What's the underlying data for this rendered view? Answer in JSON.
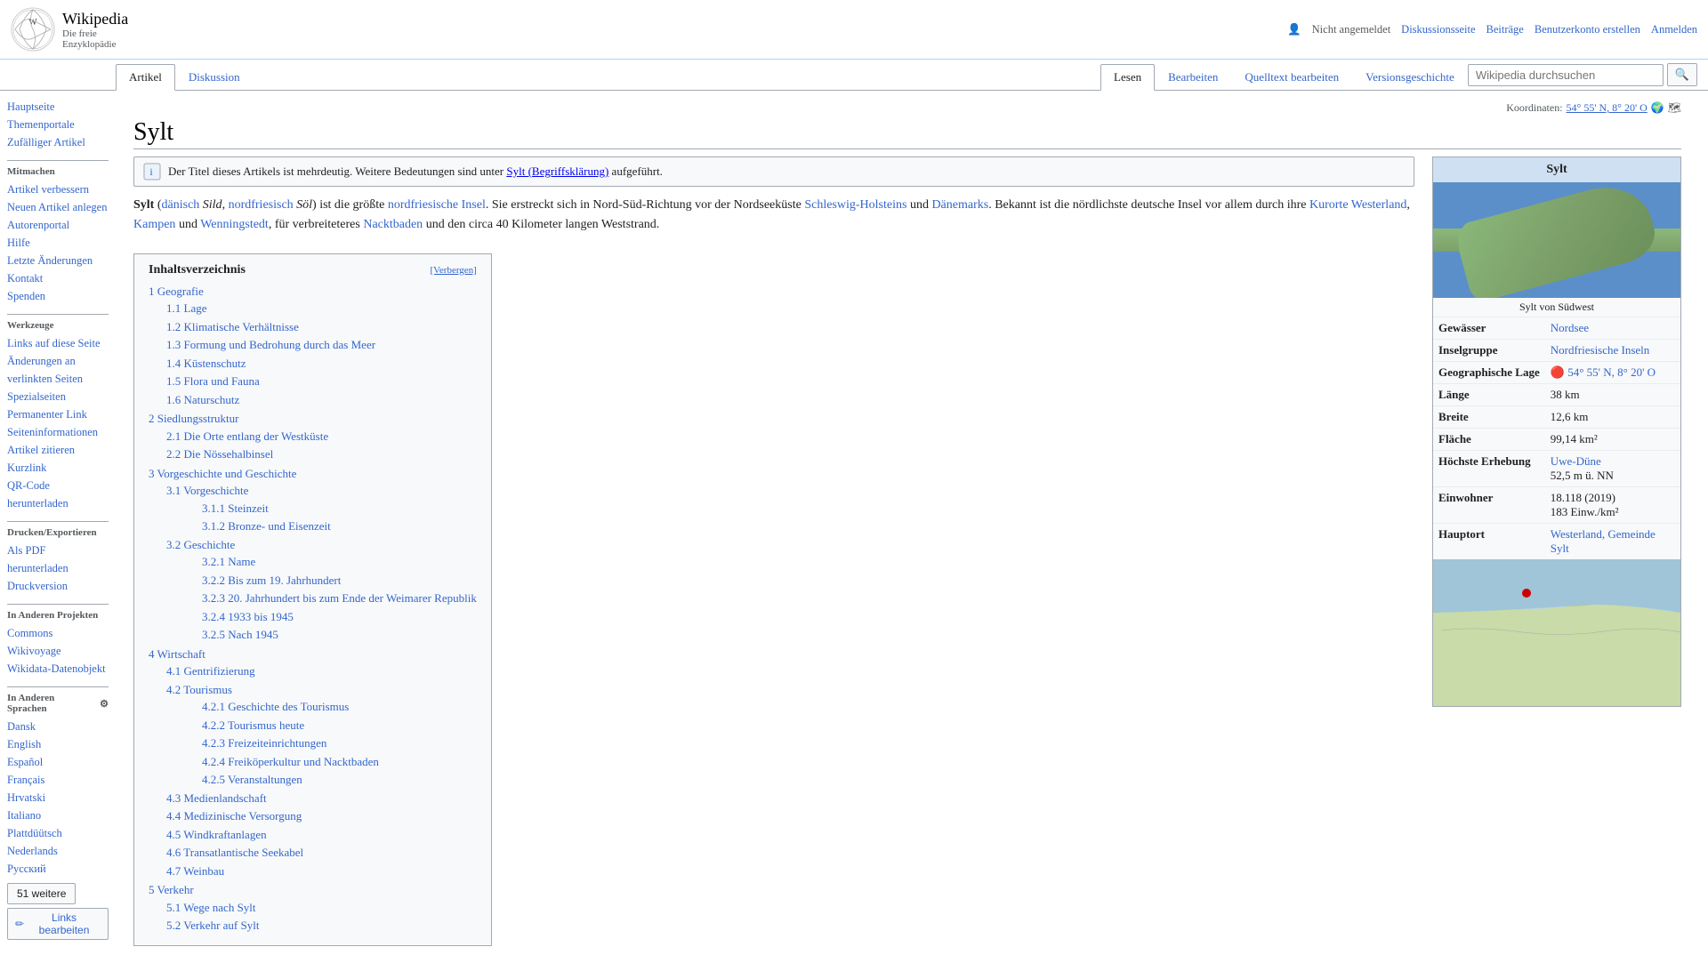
{
  "header": {
    "logo_title": "Wikipedia",
    "logo_subtitle": "Die freie Enzyklopädie",
    "top_nav": [
      {
        "label": "Nicht angemeldet",
        "type": "text"
      },
      {
        "label": "Diskussionsseite",
        "type": "link"
      },
      {
        "label": "Beiträge",
        "type": "link"
      },
      {
        "label": "Benutzerkonto erstellen",
        "type": "link"
      },
      {
        "label": "Anmelden",
        "type": "link"
      }
    ],
    "search_placeholder": "Wikipedia durchsuchen",
    "search_btn": "🔍"
  },
  "tabs": [
    {
      "label": "Artikel",
      "active": true
    },
    {
      "label": "Diskussion",
      "active": false
    },
    {
      "label": "Lesen",
      "active": false
    },
    {
      "label": "Bearbeiten",
      "active": false
    },
    {
      "label": "Quelltext bearbeiten",
      "active": false
    },
    {
      "label": "Versionsgeschichte",
      "active": false
    }
  ],
  "sidebar": {
    "sections": [
      {
        "heading": "",
        "items": [
          {
            "label": "Hauptseite",
            "type": "link"
          },
          {
            "label": "Themenportale",
            "type": "link"
          },
          {
            "label": "Zufälliger Artikel",
            "type": "link"
          }
        ]
      },
      {
        "heading": "Mitmachen",
        "items": [
          {
            "label": "Artikel verbessern",
            "type": "link"
          },
          {
            "label": "Neuen Artikel anlegen",
            "type": "link"
          },
          {
            "label": "Autorenportal",
            "type": "link"
          },
          {
            "label": "Hilfe",
            "type": "link"
          },
          {
            "label": "Letzte Änderungen",
            "type": "link"
          },
          {
            "label": "Kontakt",
            "type": "link"
          },
          {
            "label": "Spenden",
            "type": "link"
          }
        ]
      },
      {
        "heading": "Werkzeuge",
        "items": [
          {
            "label": "Links auf diese Seite",
            "type": "link"
          },
          {
            "label": "Änderungen an verlinkten Seiten",
            "type": "link"
          },
          {
            "label": "Spezialseiten",
            "type": "link"
          },
          {
            "label": "Permanenter Link",
            "type": "link"
          },
          {
            "label": "Seiteninformationen",
            "type": "link"
          },
          {
            "label": "Artikel zitieren",
            "type": "link"
          },
          {
            "label": "Kurzlink",
            "type": "link"
          },
          {
            "label": "QR-Code herunterladen",
            "type": "link"
          }
        ]
      },
      {
        "heading": "Drucken/exportieren",
        "items": [
          {
            "label": "Als PDF herunterladen",
            "type": "link"
          },
          {
            "label": "Druckversion",
            "type": "link"
          }
        ]
      },
      {
        "heading": "In anderen Projekten",
        "items": [
          {
            "label": "Commons",
            "type": "link"
          },
          {
            "label": "Wikivoyage",
            "type": "link"
          },
          {
            "label": "Wikidata-Datenobjekt",
            "type": "link"
          }
        ]
      },
      {
        "heading": "In anderen Sprachen",
        "items": [
          {
            "label": "Dansk",
            "type": "link"
          },
          {
            "label": "English",
            "type": "link"
          },
          {
            "label": "Español",
            "type": "link"
          },
          {
            "label": "Français",
            "type": "link"
          },
          {
            "label": "Hrvatski",
            "type": "link"
          },
          {
            "label": "Italiano",
            "type": "link"
          },
          {
            "label": "Plattdüütsch",
            "type": "link"
          },
          {
            "label": "Nederlands",
            "type": "link"
          },
          {
            "label": "Русский",
            "type": "link"
          }
        ]
      }
    ],
    "more_btn": "51 weitere",
    "links_btn": "Links bearbeiten"
  },
  "page": {
    "title": "Sylt",
    "coords": "54° 55' N, 8° 20' O",
    "disambig_text": "Der Titel dieses Artikels ist mehrdeutig. Weitere Bedeutungen sind unter",
    "disambig_link": "Sylt (Begriffsklärung)",
    "disambig_suffix": "aufgeführt.",
    "intro": "Sylt (dänisch Sild, nordfriesisch Söl) ist die größte nordfriesische Insel. Sie erstreckt sich in Nord-Süd-Richtung vor der Nordseeküste Schleswig-Holsteins und Dänemarks. Bekannt ist die nördlichste deutsche Insel vor allem durch ihre Kurorte Westerland, Kampen und Wenningstedt, für verbreiteteres Nacktbaden und den circa 40 Kilometer langen Weststrand."
  },
  "toc": {
    "title": "Inhaltsverzeichnis",
    "toggle": "[Verbergen]",
    "items": [
      {
        "num": "1",
        "label": "Geografie",
        "level": 1,
        "children": [
          {
            "num": "1.1",
            "label": "Lage",
            "level": 2
          },
          {
            "num": "1.2",
            "label": "Klimatische Verhältnisse",
            "level": 2
          },
          {
            "num": "1.3",
            "label": "Formung und Bedrohung durch das Meer",
            "level": 2
          },
          {
            "num": "1.4",
            "label": "Küstenschutz",
            "level": 2
          },
          {
            "num": "1.5",
            "label": "Flora und Fauna",
            "level": 2
          },
          {
            "num": "1.6",
            "label": "Naturschutz",
            "level": 2
          }
        ]
      },
      {
        "num": "2",
        "label": "Siedlungsstruktur",
        "level": 1,
        "children": [
          {
            "num": "2.1",
            "label": "Die Orte entlang der Westküste",
            "level": 2
          },
          {
            "num": "2.2",
            "label": "Die Nössehalbinsel",
            "level": 2
          }
        ]
      },
      {
        "num": "3",
        "label": "Vorgeschichte und Geschichte",
        "level": 1,
        "children": [
          {
            "num": "3.1",
            "label": "Vorgeschichte",
            "level": 2,
            "children": [
              {
                "num": "3.1.1",
                "label": "Steinzeit",
                "level": 3
              },
              {
                "num": "3.1.2",
                "label": "Bronze- und Eisenzeit",
                "level": 3
              }
            ]
          },
          {
            "num": "3.2",
            "label": "Geschichte",
            "level": 2,
            "children": [
              {
                "num": "3.2.1",
                "label": "Name",
                "level": 3
              },
              {
                "num": "3.2.2",
                "label": "Bis zum 19. Jahrhundert",
                "level": 3
              },
              {
                "num": "3.2.3",
                "label": "20. Jahrhundert bis zum Ende der Weimarer Republik",
                "level": 3
              },
              {
                "num": "3.2.4",
                "label": "1933 bis 1945",
                "level": 3
              },
              {
                "num": "3.2.5",
                "label": "Nach 1945",
                "level": 3
              }
            ]
          }
        ]
      },
      {
        "num": "4",
        "label": "Wirtschaft",
        "level": 1,
        "children": [
          {
            "num": "4.1",
            "label": "Gentrifizierung",
            "level": 2
          },
          {
            "num": "4.2",
            "label": "Tourismus",
            "level": 2,
            "children": [
              {
                "num": "4.2.1",
                "label": "Geschichte des Tourismus",
                "level": 3
              },
              {
                "num": "4.2.2",
                "label": "Tourismus heute",
                "level": 3
              },
              {
                "num": "4.2.3",
                "label": "Freizeiteinrichtungen",
                "level": 3
              },
              {
                "num": "4.2.4",
                "label": "Freiköperkultur und Nacktbaden",
                "level": 3
              },
              {
                "num": "4.2.5",
                "label": "Veranstaltungen",
                "level": 3
              }
            ]
          },
          {
            "num": "4.3",
            "label": "Medienlandschaft",
            "level": 2
          },
          {
            "num": "4.4",
            "label": "Medizinische Versorgung",
            "level": 2
          },
          {
            "num": "4.5",
            "label": "Windkraftanlagen",
            "level": 2
          },
          {
            "num": "4.6",
            "label": "Transatlantische Seekabel",
            "level": 2
          },
          {
            "num": "4.7",
            "label": "Weinbau",
            "level": 2
          }
        ]
      },
      {
        "num": "5",
        "label": "Verkehr",
        "level": 1,
        "children": [
          {
            "num": "5.1",
            "label": "Wege nach Sylt",
            "level": 2
          },
          {
            "num": "5.2",
            "label": "Verkehr auf Sylt",
            "level": 2
          }
        ]
      }
    ]
  },
  "infobox": {
    "title": "Sylt",
    "image_caption": "Sylt von Südwest",
    "rows": [
      {
        "label": "Gewässer",
        "value": "Nordsee",
        "link": true
      },
      {
        "label": "Inselgruppe",
        "value": "Nordfriesische Inseln",
        "link": true
      },
      {
        "label": "Geographische Lage",
        "value": "54° 55' N, 8° 20' O"
      },
      {
        "label": "Länge",
        "value": "38 km"
      },
      {
        "label": "Breite",
        "value": "12,6 km"
      },
      {
        "label": "Fläche",
        "value": "99,14 km²"
      },
      {
        "label": "Höchste Erhebung",
        "value": "Uwe-Düne\n52,5 m ü. NN",
        "link": true
      },
      {
        "label": "Einwohner",
        "value": "18.118 (2019)\n183 Einw./km²"
      },
      {
        "label": "Hauptort",
        "value": "Westerland, Gemeinde Sylt",
        "link": true
      }
    ]
  }
}
